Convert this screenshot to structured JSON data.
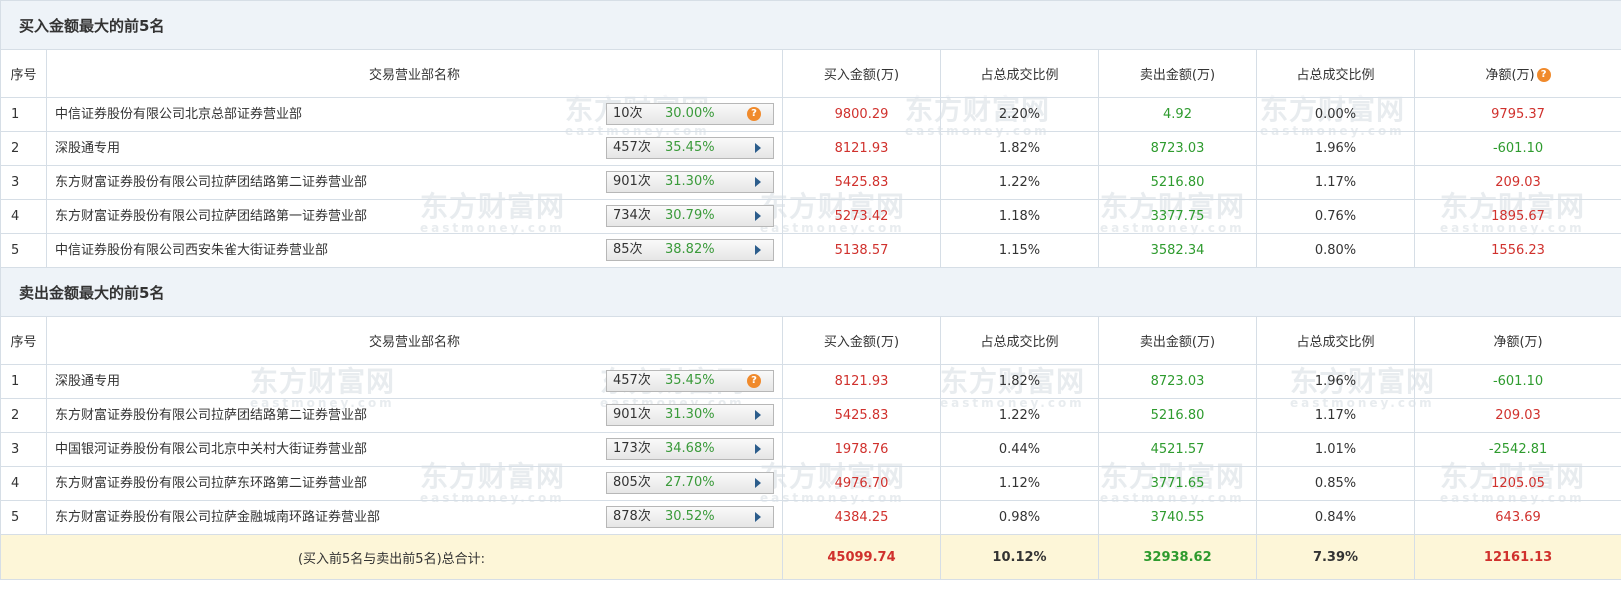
{
  "watermark": {
    "cn": "东方财富网",
    "en": "eastmoney.com"
  },
  "columns": {
    "idx": "序号",
    "name": "交易营业部名称",
    "buy": "买入金额(万)",
    "buy_pct": "占总成交比例",
    "sell": "卖出金额(万)",
    "sell_pct": "占总成交比例",
    "net": "净额(万)"
  },
  "buy_top5": {
    "title": "买入金额最大的前5名",
    "rows": [
      {
        "idx": "1",
        "name": "中信证券股份有限公司北京总部证券营业部",
        "count": "10次",
        "rate": "30.00%",
        "buy": "9800.29",
        "buy_pct": "2.20%",
        "sell": "4.92",
        "sell_pct": "0.00%",
        "net": "9795.37"
      },
      {
        "idx": "2",
        "name": "深股通专用",
        "count": "457次",
        "rate": "35.45%",
        "buy": "8121.93",
        "buy_pct": "1.82%",
        "sell": "8723.03",
        "sell_pct": "1.96%",
        "net": "-601.10"
      },
      {
        "idx": "3",
        "name": "东方财富证券股份有限公司拉萨团结路第二证券营业部",
        "count": "901次",
        "rate": "31.30%",
        "buy": "5425.83",
        "buy_pct": "1.22%",
        "sell": "5216.80",
        "sell_pct": "1.17%",
        "net": "209.03"
      },
      {
        "idx": "4",
        "name": "东方财富证券股份有限公司拉萨团结路第一证券营业部",
        "count": "734次",
        "rate": "30.79%",
        "buy": "5273.42",
        "buy_pct": "1.18%",
        "sell": "3377.75",
        "sell_pct": "0.76%",
        "net": "1895.67"
      },
      {
        "idx": "5",
        "name": "中信证券股份有限公司西安朱雀大街证券营业部",
        "count": "85次",
        "rate": "38.82%",
        "buy": "5138.57",
        "buy_pct": "1.15%",
        "sell": "3582.34",
        "sell_pct": "0.80%",
        "net": "1556.23"
      }
    ]
  },
  "sell_top5": {
    "title": "卖出金额最大的前5名",
    "rows": [
      {
        "idx": "1",
        "name": "深股通专用",
        "count": "457次",
        "rate": "35.45%",
        "buy": "8121.93",
        "buy_pct": "1.82%",
        "sell": "8723.03",
        "sell_pct": "1.96%",
        "net": "-601.10"
      },
      {
        "idx": "2",
        "name": "东方财富证券股份有限公司拉萨团结路第二证券营业部",
        "count": "901次",
        "rate": "31.30%",
        "buy": "5425.83",
        "buy_pct": "1.22%",
        "sell": "5216.80",
        "sell_pct": "1.17%",
        "net": "209.03"
      },
      {
        "idx": "3",
        "name": "中国银河证券股份有限公司北京中关村大街证券营业部",
        "count": "173次",
        "rate": "34.68%",
        "buy": "1978.76",
        "buy_pct": "0.44%",
        "sell": "4521.57",
        "sell_pct": "1.01%",
        "net": "-2542.81"
      },
      {
        "idx": "4",
        "name": "东方财富证券股份有限公司拉萨东环路第二证券营业部",
        "count": "805次",
        "rate": "27.70%",
        "buy": "4976.70",
        "buy_pct": "1.12%",
        "sell": "3771.65",
        "sell_pct": "0.85%",
        "net": "1205.05"
      },
      {
        "idx": "5",
        "name": "东方财富证券股份有限公司拉萨金融城南环路证券营业部",
        "count": "878次",
        "rate": "30.52%",
        "buy": "4384.25",
        "buy_pct": "0.98%",
        "sell": "3740.55",
        "sell_pct": "0.84%",
        "net": "643.69"
      }
    ]
  },
  "total": {
    "label": "(买入前5名与卖出前5名)总合计:",
    "buy": "45099.74",
    "buy_pct": "10.12%",
    "sell": "32938.62",
    "sell_pct": "7.39%",
    "net": "12161.13"
  },
  "colors": {
    "red": "#d0312d",
    "green": "#2e9b2e",
    "header_bg": "#eef3f8",
    "total_bg": "#fdf6d8",
    "help_icon": "#f08a2c"
  }
}
